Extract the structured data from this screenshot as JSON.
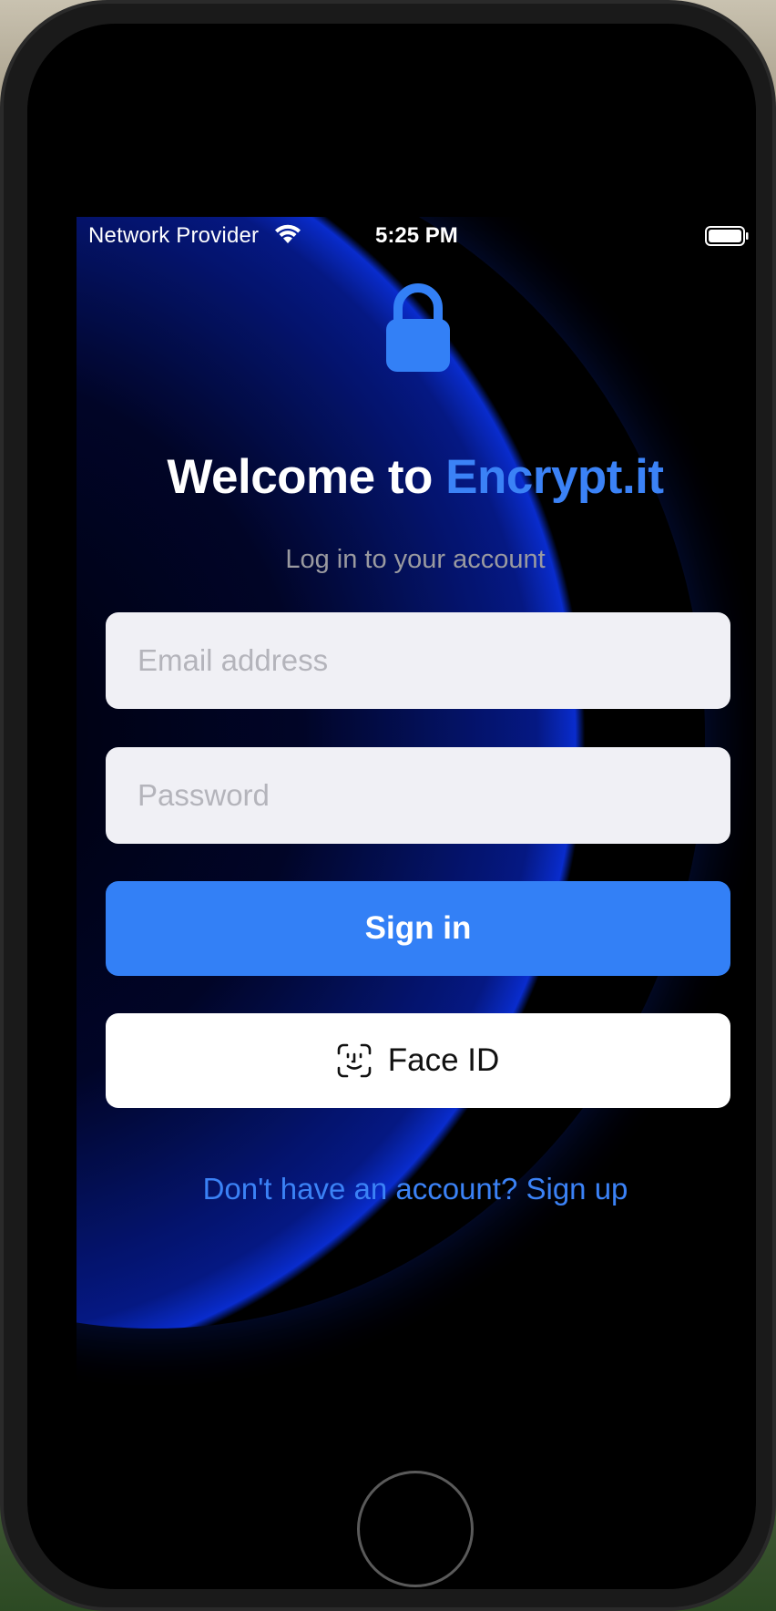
{
  "status_bar": {
    "carrier": "Network Provider",
    "time": "5:25 PM",
    "wifi_icon": "wifi-icon",
    "battery_icon": "battery-icon"
  },
  "header": {
    "icon": "lock-icon",
    "title_prefix": "Welcome to ",
    "title_brand": "Encrypt.it",
    "subtitle": "Log in to your account"
  },
  "form": {
    "email_placeholder": "Email address",
    "email_value": "",
    "password_placeholder": "Password",
    "password_value": ""
  },
  "actions": {
    "sign_in_label": "Sign in",
    "face_id_label": "Face ID",
    "face_id_icon": "face-id-icon",
    "signup_link": "Don't have an account? Sign up"
  },
  "colors": {
    "accent": "#3380f6",
    "background": "#000000",
    "field_background": "#f0f0f5"
  }
}
